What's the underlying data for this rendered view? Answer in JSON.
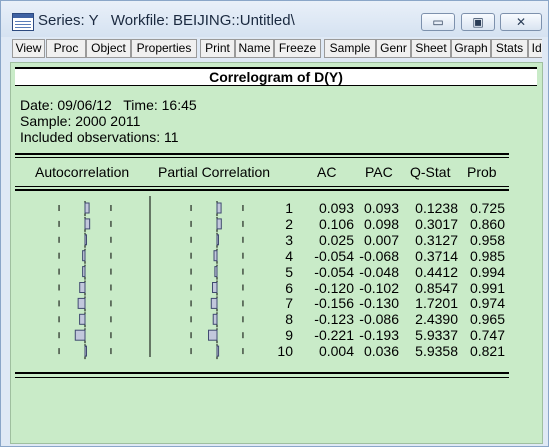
{
  "window": {
    "title": "Series: Y   Workfile: BEIJING::Untitled\\",
    "minimize_glyph": "▭",
    "maximize_glyph": "▣",
    "close_glyph": "✕"
  },
  "toolbar": [
    "View",
    "Proc",
    "Object",
    "Properties",
    "Print",
    "Name",
    "Freeze",
    "Sample",
    "Genr",
    "Sheet",
    "Graph",
    "Stats",
    "Ider"
  ],
  "heading": "Correlogram of D(Y)",
  "info": {
    "date_line": "Date: 09/06/12   Time: 16:45",
    "sample_line": "Sample: 2000 2011",
    "obs_line": "Included observations: 11"
  },
  "columns": {
    "autocorrelation": "Autocorrelation",
    "partial_correlation": "Partial Correlation",
    "ac": "AC",
    "pac": "PAC",
    "qstat": "Q-Stat",
    "prob": "Prob"
  },
  "chart_data": {
    "type": "table",
    "rows": [
      {
        "lag": "1",
        "ac": "0.093",
        "pac": "0.093",
        "q": "0.1238",
        "prob": "0.725"
      },
      {
        "lag": "2",
        "ac": "0.106",
        "pac": "0.098",
        "q": "0.3017",
        "prob": "0.860"
      },
      {
        "lag": "3",
        "ac": "0.025",
        "pac": "0.007",
        "q": "0.3127",
        "prob": "0.958"
      },
      {
        "lag": "4",
        "ac": "-0.054",
        "pac": "-0.068",
        "q": "0.3714",
        "prob": "0.985"
      },
      {
        "lag": "5",
        "ac": "-0.054",
        "pac": "-0.048",
        "q": "0.4412",
        "prob": "0.994"
      },
      {
        "lag": "6",
        "ac": "-0.120",
        "pac": "-0.102",
        "q": "0.8547",
        "prob": "0.991"
      },
      {
        "lag": "7",
        "ac": "-0.156",
        "pac": "-0.130",
        "q": "1.7201",
        "prob": "0.974"
      },
      {
        "lag": "8",
        "ac": "-0.123",
        "pac": "-0.086",
        "q": "2.4390",
        "prob": "0.965"
      },
      {
        "lag": "9",
        "ac": "-0.221",
        "pac": "-0.193",
        "q": "5.9337",
        "prob": "0.747"
      },
      {
        "lag": "10",
        "ac": "0.004",
        "pac": "0.036",
        "q": "5.9358",
        "prob": "0.821"
      }
    ],
    "confidence_bound": 0.59
  }
}
